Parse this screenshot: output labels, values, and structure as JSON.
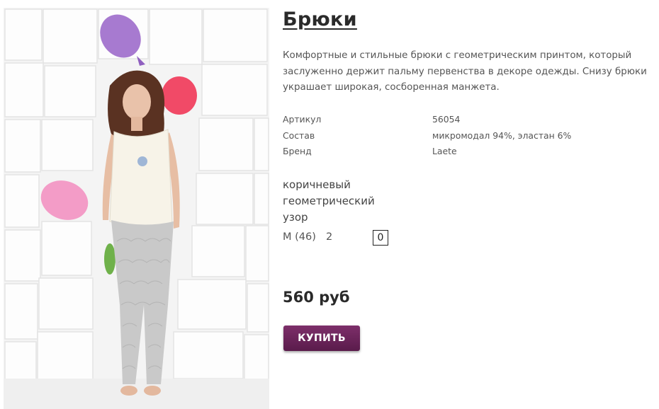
{
  "product": {
    "title": "Брюки",
    "description": "Комфортные и стильные брюки с геометрическим принтом, который заслуженно держит пальму первенства в декоре одежды. Снизу брюки украшает широкая, сосборенная манжета.",
    "properties": [
      {
        "key": "Артикул",
        "value": "56054"
      },
      {
        "key": "Состав",
        "value": "микромодал 94%, эластан 6%"
      },
      {
        "key": "Бренд",
        "value": "Laete"
      }
    ],
    "variant_name": "коричневый геометрический узор",
    "size": {
      "label": "M (46)",
      "stock": "2",
      "quantity": "0"
    },
    "price": "560 руб",
    "buy_label": "КУПИТЬ",
    "colors": {
      "buy_button": "#6b2459",
      "title": "#2a2a2a",
      "text": "#555555"
    }
  }
}
